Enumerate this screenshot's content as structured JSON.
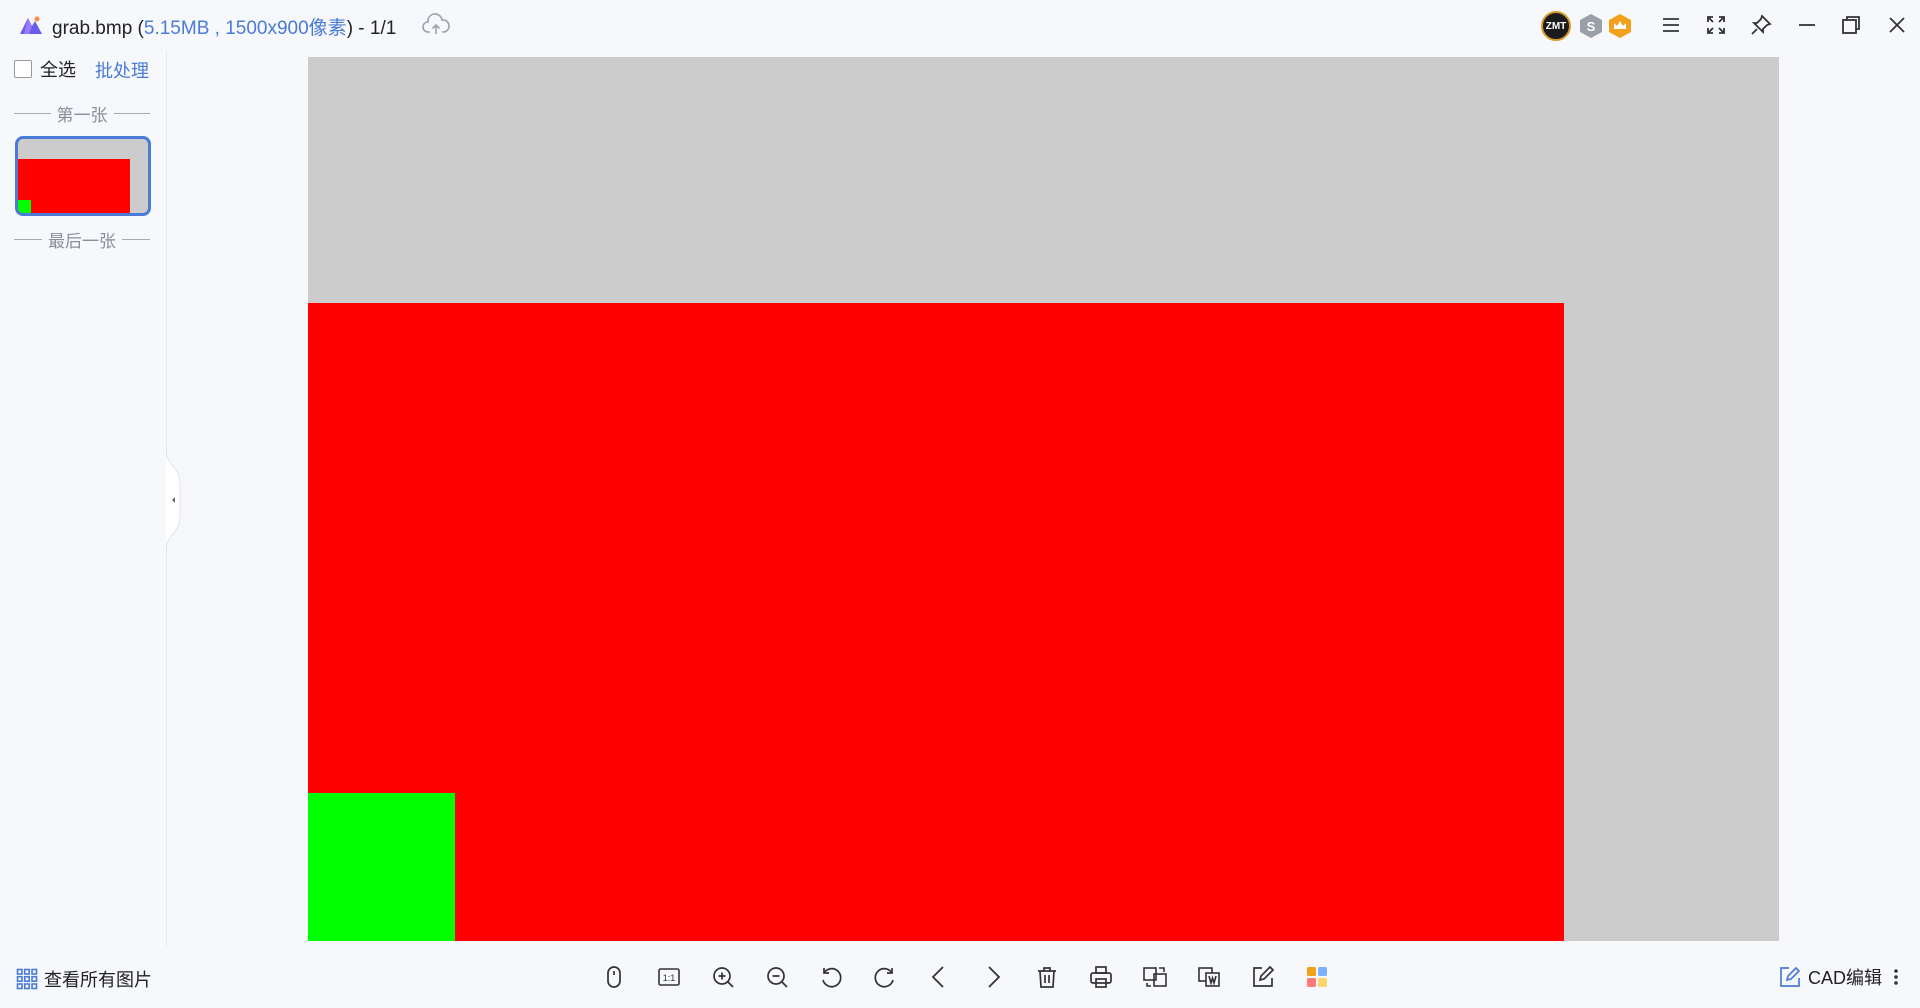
{
  "window": {
    "title_file": "grab.bmp",
    "title_open": " (",
    "title_meta": "5.15MB , 1500x900像素",
    "title_close": ") - 1/1",
    "zmt_badge": "ZMT",
    "s_badge": "S"
  },
  "sidebar": {
    "select_all_label": "全选",
    "batch_label": "批处理",
    "first_divider": "第一张",
    "last_divider": "最后一张"
  },
  "image": {
    "background_color": "#cccccc",
    "red_color": "#ff0000",
    "green_color": "#00ff00"
  },
  "bottombar": {
    "view_all_label": "查看所有图片",
    "cad_label": "CAD编辑"
  },
  "icons": {
    "toolbar": [
      "mouse-icon",
      "actual-size-icon",
      "zoom-in-icon",
      "zoom-out-icon",
      "rotate-left-icon",
      "rotate-right-icon",
      "previous-icon",
      "next-icon",
      "delete-icon",
      "print-icon",
      "convert-icon",
      "to-word-icon",
      "edit-icon",
      "apps-icon"
    ],
    "actual_size_text": "1:1"
  },
  "colors": {
    "accent": "#4a7bd6",
    "orange": "#f3a11a"
  }
}
